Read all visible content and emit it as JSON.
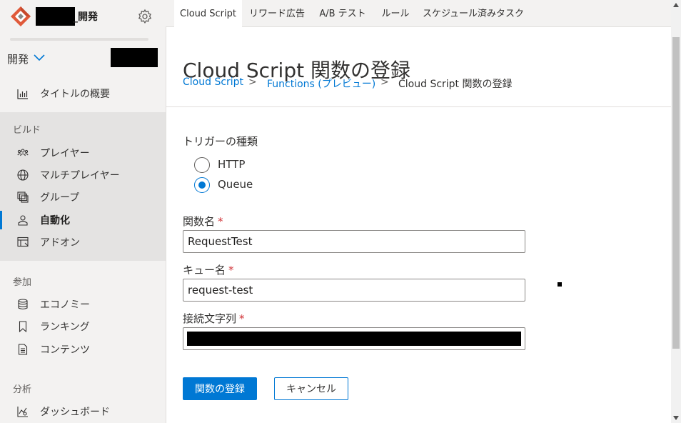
{
  "app": {
    "title_suffix": "_開発",
    "environment": "開発",
    "settings_icon": "gear-icon",
    "logo_icon": "playfab-logo"
  },
  "sidebar": {
    "overview": {
      "label": "タイトルの概要",
      "icon": "bar-chart-icon"
    },
    "sections": [
      {
        "header": "ビルド",
        "items": [
          {
            "label": "プレイヤー",
            "icon": "players-icon"
          },
          {
            "label": "マルチプレイヤー",
            "icon": "globe-icon"
          },
          {
            "label": "グループ",
            "icon": "groups-icon"
          },
          {
            "label": "自動化",
            "icon": "automation-icon",
            "active": true
          },
          {
            "label": "アドオン",
            "icon": "addons-icon"
          }
        ]
      },
      {
        "header": "参加",
        "items": [
          {
            "label": "エコノミー",
            "icon": "database-icon"
          },
          {
            "label": "ランキング",
            "icon": "bookmark-icon"
          },
          {
            "label": "コンテンツ",
            "icon": "document-icon"
          }
        ]
      },
      {
        "header": "分析",
        "items": [
          {
            "label": "ダッシュボード",
            "icon": "dashboard-icon"
          }
        ]
      }
    ]
  },
  "tabs": [
    {
      "label": "Cloud Script",
      "active": true
    },
    {
      "label": "リワード広告"
    },
    {
      "label": "A/B テスト"
    },
    {
      "label": "ルール"
    },
    {
      "label": "スケジュール済みタスク"
    }
  ],
  "header": {
    "title": "Cloud Script 関数の登録",
    "breadcrumb": [
      {
        "label": "Cloud Script",
        "link": true
      },
      {
        "label": "Functions (プレビュー)",
        "link": true
      },
      {
        "label": "Cloud Script 関数の登録",
        "link": false
      }
    ],
    "separator": ">"
  },
  "form": {
    "trigger_label": "トリガーの種類",
    "trigger_options": [
      {
        "label": "HTTP",
        "checked": false
      },
      {
        "label": "Queue",
        "checked": true
      }
    ],
    "function_name_label": "関数名",
    "function_name_value": "RequestTest",
    "queue_name_label": "キュー名",
    "queue_name_value": "request-test",
    "connection_string_label": "接続文字列",
    "connection_string_value": "",
    "required_mark": "*",
    "submit_label": "関数の登録",
    "cancel_label": "キャンセル"
  },
  "colors": {
    "accent": "#0078d4",
    "required": "#d13438",
    "sidebar_bg": "#f3f2f1",
    "section_bg": "#e4e3e2"
  }
}
